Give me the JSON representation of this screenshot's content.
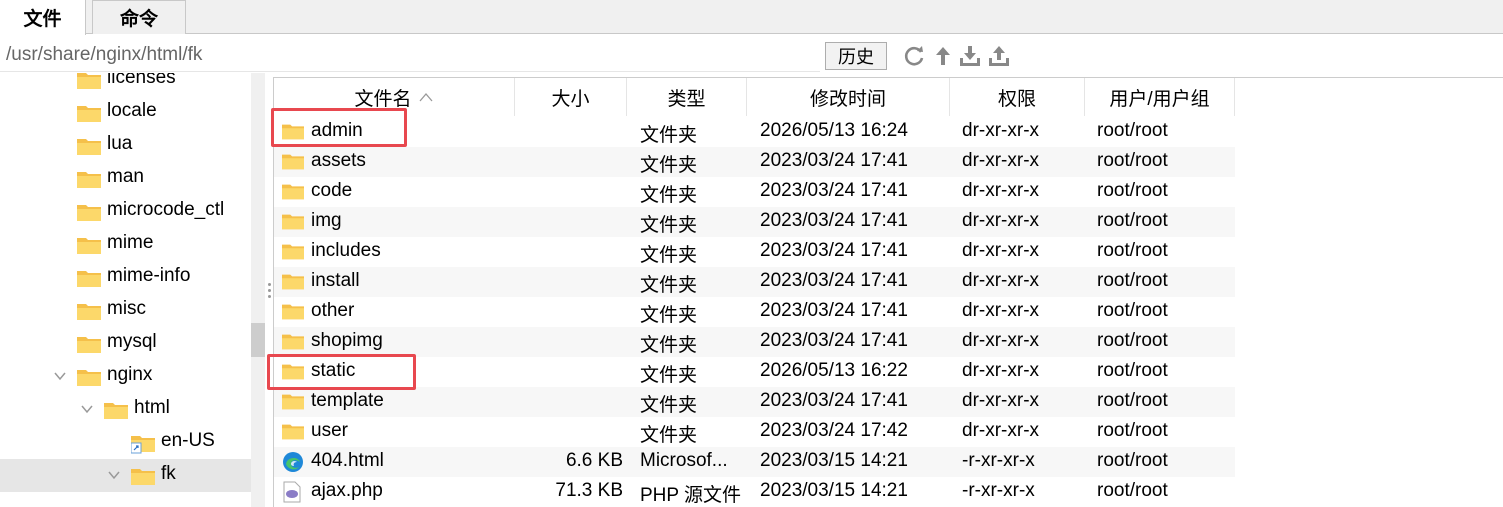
{
  "tabs": [
    {
      "label": "文件"
    },
    {
      "label": "命令"
    }
  ],
  "path": "/usr/share/nginx/html/fk",
  "history_label": "历史",
  "toolbar_icons": [
    "refresh-icon",
    "up-arrow-icon",
    "download-icon",
    "upload-icon"
  ],
  "tree": [
    {
      "label": "licenses"
    },
    {
      "label": "locale"
    },
    {
      "label": "lua"
    },
    {
      "label": "man"
    },
    {
      "label": "microcode_ctl"
    },
    {
      "label": "mime"
    },
    {
      "label": "mime-info"
    },
    {
      "label": "misc"
    },
    {
      "label": "mysql"
    },
    {
      "label": "nginx"
    },
    {
      "label": "html"
    },
    {
      "label": "en-US"
    },
    {
      "label": "fk"
    }
  ],
  "columns": [
    "文件名",
    "大小",
    "类型",
    "修改时间",
    "权限",
    "用户/用户组"
  ],
  "files": [
    {
      "name": "admin",
      "size": "",
      "type": "文件夹",
      "modified": "2026/05/13 16:24",
      "perm": "dr-xr-xr-x",
      "owner": "root/root"
    },
    {
      "name": "assets",
      "size": "",
      "type": "文件夹",
      "modified": "2023/03/24 17:41",
      "perm": "dr-xr-xr-x",
      "owner": "root/root"
    },
    {
      "name": "code",
      "size": "",
      "type": "文件夹",
      "modified": "2023/03/24 17:41",
      "perm": "dr-xr-xr-x",
      "owner": "root/root"
    },
    {
      "name": "img",
      "size": "",
      "type": "文件夹",
      "modified": "2023/03/24 17:41",
      "perm": "dr-xr-xr-x",
      "owner": "root/root"
    },
    {
      "name": "includes",
      "size": "",
      "type": "文件夹",
      "modified": "2023/03/24 17:41",
      "perm": "dr-xr-xr-x",
      "owner": "root/root"
    },
    {
      "name": "install",
      "size": "",
      "type": "文件夹",
      "modified": "2023/03/24 17:41",
      "perm": "dr-xr-xr-x",
      "owner": "root/root"
    },
    {
      "name": "other",
      "size": "",
      "type": "文件夹",
      "modified": "2023/03/24 17:41",
      "perm": "dr-xr-xr-x",
      "owner": "root/root"
    },
    {
      "name": "shopimg",
      "size": "",
      "type": "文件夹",
      "modified": "2023/03/24 17:41",
      "perm": "dr-xr-xr-x",
      "owner": "root/root"
    },
    {
      "name": "static",
      "size": "",
      "type": "文件夹",
      "modified": "2026/05/13 16:22",
      "perm": "dr-xr-xr-x",
      "owner": "root/root"
    },
    {
      "name": "template",
      "size": "",
      "type": "文件夹",
      "modified": "2023/03/24 17:41",
      "perm": "dr-xr-xr-x",
      "owner": "root/root"
    },
    {
      "name": "user",
      "size": "",
      "type": "文件夹",
      "modified": "2023/03/24 17:42",
      "perm": "dr-xr-xr-x",
      "owner": "root/root"
    },
    {
      "name": "404.html",
      "size": "6.6 KB",
      "type": "Microsof...",
      "modified": "2023/03/15 14:21",
      "perm": "-r-xr-xr-x",
      "owner": "root/root"
    },
    {
      "name": "ajax.php",
      "size": "71.3 KB",
      "type": "PHP 源文件",
      "modified": "2023/03/15 14:21",
      "perm": "-r-xr-xr-x",
      "owner": "root/root"
    }
  ],
  "colors": {
    "highlight": "#e8484f",
    "folder": "#f5c04a",
    "selected_row": "#e6e6e6"
  }
}
